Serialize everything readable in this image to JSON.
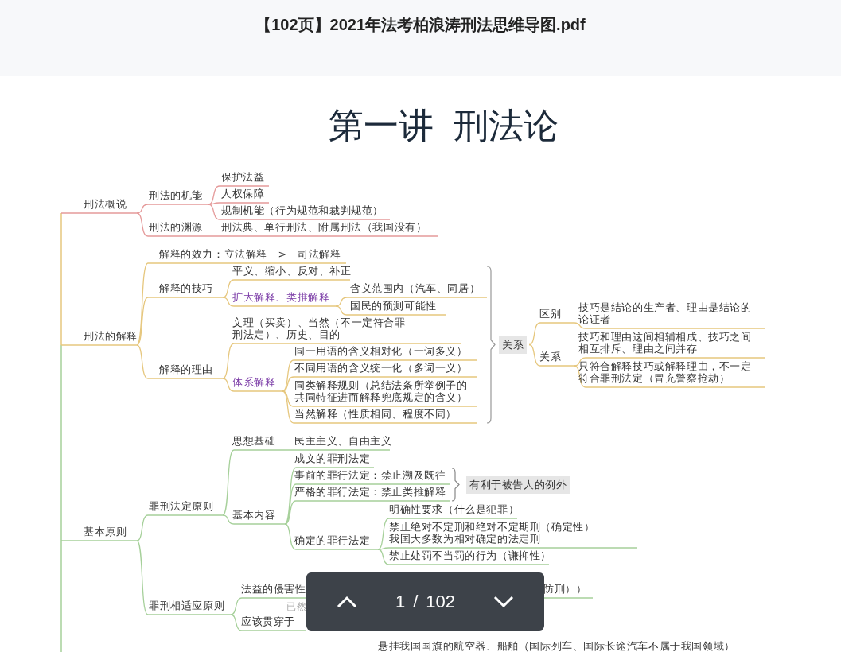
{
  "document": {
    "title": "【102页】2021年法考柏浪涛刑法思维导图.pdf"
  },
  "page": {
    "heading": "第一讲 刑法论",
    "mind_map": {
      "branches": [
        {
          "label": "刑法概说",
          "color": "#e59a9a",
          "children": [
            {
              "label": "刑法的机能",
              "children": [
                {
                  "label": "保护法益"
                },
                {
                  "label": "人权保障"
                },
                {
                  "label": "规制机能（行为规范和裁判规范）"
                }
              ]
            },
            {
              "label": "刑法的渊源",
              "children": [
                {
                  "label": "刑法典、单行刑法、附属刑法（我国没有）"
                }
              ]
            }
          ]
        },
        {
          "label": "刑法的解释",
          "color": "#e6c77e",
          "children": [
            {
              "label": "解释的效力：立法解释　>　司法解释"
            },
            {
              "label": "解释的技巧",
              "children": [
                {
                  "label": "平义、缩小、反对、补正"
                },
                {
                  "label": "扩大解释、类推解释",
                  "kind": "highlight",
                  "children": [
                    {
                      "label": "含义范围内（汽车、同居）"
                    },
                    {
                      "label": "国民的预测可能性"
                    }
                  ]
                }
              ]
            },
            {
              "label": "解释的理由",
              "children": [
                {
                  "lines": [
                    "文理（买卖）、当然（不一定符合罪",
                    "刑法定）、历史、目的"
                  ]
                },
                {
                  "label": "体系解释",
                  "kind": "highlight",
                  "children": [
                    {
                      "label": "同一用语的含义相对化（一词多义）"
                    },
                    {
                      "label": "不同用语的含义统一化（多词一义）"
                    },
                    {
                      "lines": [
                        "同类解释规则（总结法条所举例子的",
                        "共同特征进而解释兜底规定的含义）"
                      ]
                    },
                    {
                      "label": "当然解释（性质相同、程度不同）"
                    }
                  ]
                }
              ]
            }
          ],
          "relation": {
            "label": "关系",
            "children": [
              {
                "label": "区别",
                "children": [
                  {
                    "lines": [
                      "技巧是结论的生产者、理由是结论的",
                      "论证者"
                    ]
                  }
                ]
              },
              {
                "label": "关系",
                "children": [
                  {
                    "lines": [
                      "技巧和理由这间相辅相成、技巧之间",
                      "相互排斥、理由之间并存"
                    ]
                  },
                  {
                    "lines": [
                      "只符合解释技巧或解释理由，不一定",
                      "符合罪刑法定（冒充警察抢劫）"
                    ]
                  }
                ]
              }
            ]
          }
        },
        {
          "label": "基本原则",
          "color": "#a6d09a",
          "children": [
            {
              "label": "罪刑法定原则",
              "children": [
                {
                  "label": "思想基础",
                  "children": [
                    {
                      "label": "民主主义、自由主义"
                    }
                  ]
                },
                {
                  "label": "基本内容",
                  "bracket_note": "有利于被告人的例外",
                  "children": [
                    {
                      "label": "成文的罪刑法定"
                    },
                    {
                      "label": "事前的罪行法定：禁止溯及既往"
                    },
                    {
                      "label": "严格的罪行法定：禁止类推解释"
                    },
                    {
                      "label": "确定的罪行法定",
                      "children": [
                        {
                          "label": "明确性要求（什么是犯罪）"
                        },
                        {
                          "lines": [
                            "禁止绝对不定刑和绝对不定期刑（确定性）",
                            "我国大多数为相对确定的法定刑"
                          ]
                        },
                        {
                          "label": "禁止处罚不当罚的行为（谦抑性）"
                        }
                      ]
                    }
                  ]
                }
              ]
            },
            {
              "label": "罪刑相适应原则",
              "children": [
                {
                  "label": "法益的侵害性",
                  "children": [
                    {
                      "label": "防刑））"
                    }
                  ]
                },
                {
                  "label": "已然",
                  "kind": "faded"
                },
                {
                  "label": "应该贯穿于"
                }
              ]
            }
          ]
        }
      ]
    },
    "cut_off_line": "悬挂我国国旗的航空器、船舶（国际列车、国际长途汽车不属于我国领域）"
  },
  "pager": {
    "current": "1",
    "separator": "/",
    "total": "102"
  }
}
